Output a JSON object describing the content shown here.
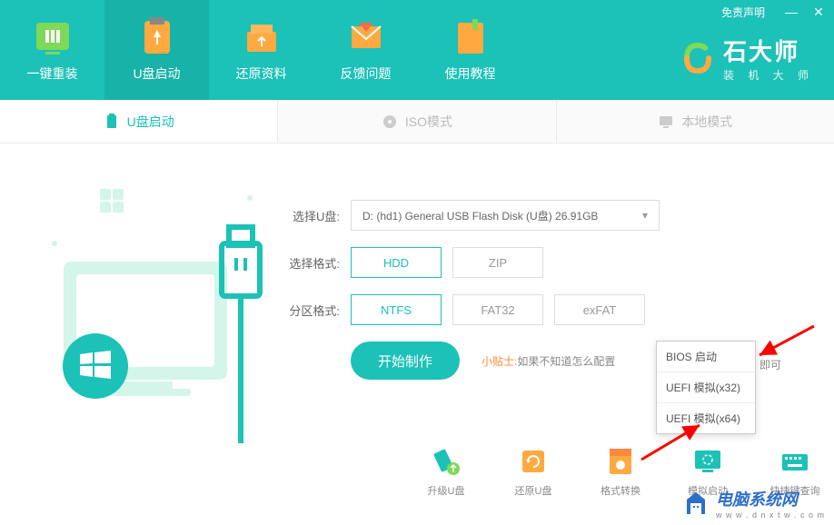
{
  "window": {
    "disclaimer": "免责声明",
    "minimize": "—",
    "close": "✕"
  },
  "brand": {
    "title": "石大师",
    "subtitle": "装 机 大 师"
  },
  "nav": {
    "items": [
      {
        "label": "一键重装",
        "icon": "reinstall"
      },
      {
        "label": "U盘启动",
        "icon": "usb-boot"
      },
      {
        "label": "还原资料",
        "icon": "restore"
      },
      {
        "label": "反馈问题",
        "icon": "feedback"
      },
      {
        "label": "使用教程",
        "icon": "tutorial"
      }
    ]
  },
  "tabs": {
    "items": [
      {
        "label": "U盘启动",
        "icon": "usb"
      },
      {
        "label": "ISO模式",
        "icon": "iso"
      },
      {
        "label": "本地模式",
        "icon": "local"
      }
    ]
  },
  "form": {
    "selectUsb": {
      "label": "选择U盘:",
      "value": "D: (hd1) General USB Flash Disk  (U盘) 26.91GB"
    },
    "format": {
      "label": "选择格式:",
      "options": [
        "HDD",
        "ZIP"
      ]
    },
    "partition": {
      "label": "分区格式:",
      "options": [
        "NTFS",
        "FAT32",
        "exFAT"
      ]
    },
    "startBtn": "开始制作",
    "tip": {
      "label": "小贴士:",
      "text": "如果不知道怎么配置"
    },
    "tipSuffix": "即可"
  },
  "popup": {
    "items": [
      "BIOS 启动",
      "UEFI 模拟(x32)",
      "UEFI 模拟(x64)"
    ]
  },
  "tools": {
    "items": [
      {
        "label": "升级U盘",
        "icon": "upgrade"
      },
      {
        "label": "还原U盘",
        "icon": "restore-usb"
      },
      {
        "label": "格式转换",
        "icon": "convert"
      },
      {
        "label": "模拟启动",
        "icon": "simulate"
      },
      {
        "label": "快捷键查询",
        "icon": "hotkey"
      }
    ]
  },
  "watermark": {
    "title": "电脑系统网",
    "url": "w w w . d n x t w . c o m"
  }
}
